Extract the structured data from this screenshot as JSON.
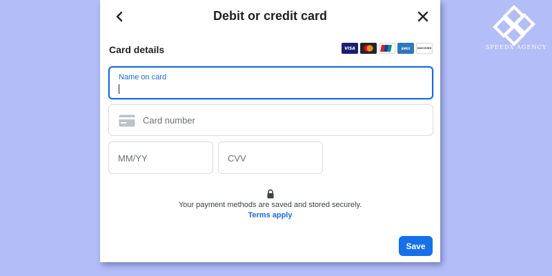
{
  "dialog": {
    "title": "Debit or credit card"
  },
  "card_details": {
    "section_title": "Card details",
    "brands": [
      "VISA",
      "Mastercard",
      "UnionPay",
      "AMEX",
      "DISCOVER"
    ],
    "brand_visa_text": "VISA",
    "brand_amex_text": "AMEX",
    "brand_discover_text": "DISCOVER"
  },
  "fields": {
    "name_label": "Name on card",
    "name_value": "",
    "card_number_placeholder": "Card number",
    "expiry_placeholder": "MM/YY",
    "cvv_placeholder": "CVV"
  },
  "security": {
    "note": "Your payment methods are saved and stored securely.",
    "terms_link": "Terms apply"
  },
  "actions": {
    "save_label": "Save"
  },
  "watermark": {
    "agency_name": "SPEEDX AGENCY"
  },
  "colors": {
    "background": "#b3bdf7",
    "accent": "#1a6ad8",
    "save_button": "#1670e8"
  },
  "icons": {
    "back": "chevron-left-icon",
    "close": "close-icon",
    "card": "credit-card-icon",
    "lock": "lock-icon"
  }
}
